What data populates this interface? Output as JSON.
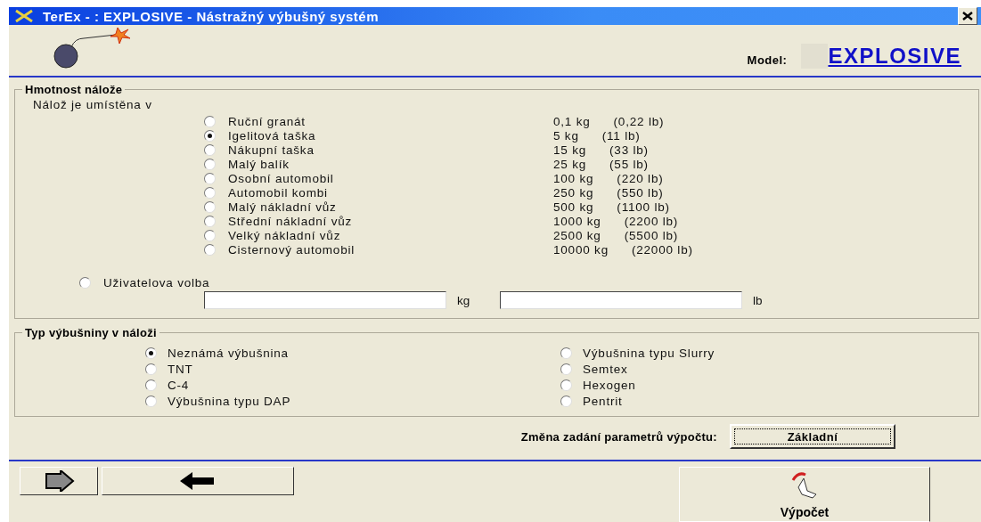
{
  "window": {
    "title": "TerEx - : EXPLOSIVE - Nástražný výbušný systém"
  },
  "header": {
    "model_label": "Model:",
    "model_value": "EXPLOSIVE"
  },
  "charge_group": {
    "title": "Hmotnost nálože",
    "prompt": "Nálož je umístěna v",
    "options": [
      {
        "label": "Ruční granát",
        "kg": "0,1 kg",
        "lb": "(0,22 lb)",
        "selected": false
      },
      {
        "label": "Igelitová taška",
        "kg": "5 kg",
        "lb": "(11 lb)",
        "selected": true
      },
      {
        "label": "Nákupní taška",
        "kg": "15 kg",
        "lb": "(33 lb)",
        "selected": false
      },
      {
        "label": "Malý balík",
        "kg": "25 kg",
        "lb": "(55 lb)",
        "selected": false
      },
      {
        "label": "Osobní automobil",
        "kg": "100 kg",
        "lb": "(220 lb)",
        "selected": false
      },
      {
        "label": "Automobil kombi",
        "kg": "250 kg",
        "lb": "(550 lb)",
        "selected": false
      },
      {
        "label": "Malý nákladní vůz",
        "kg": "500 kg",
        "lb": "(1100 lb)",
        "selected": false
      },
      {
        "label": "Střední nákladní vůz",
        "kg": "1000 kg",
        "lb": "(2200 lb)",
        "selected": false
      },
      {
        "label": "Velký nákladní vůz",
        "kg": "2500 kg",
        "lb": "(5500 lb)",
        "selected": false
      },
      {
        "label": "Cisternový automobil",
        "kg": "10000 kg",
        "lb": "(22000 lb)",
        "selected": false
      }
    ],
    "custom": {
      "label": "Uživatelova volba",
      "selected": false,
      "kg_unit": "kg",
      "lb_unit": "lb"
    }
  },
  "explosive_group": {
    "title": "Typ výbušniny v náloži",
    "options": [
      {
        "label": "Neznámá výbušnina",
        "selected": true
      },
      {
        "label": "TNT",
        "selected": false
      },
      {
        "label": "C-4",
        "selected": false
      },
      {
        "label": "Výbušnina typu DAP",
        "selected": false
      },
      {
        "label": "Výbušnina typu Slurry",
        "selected": false
      },
      {
        "label": "Semtex",
        "selected": false
      },
      {
        "label": "Hexogen",
        "selected": false
      },
      {
        "label": "Pentrit",
        "selected": false
      }
    ]
  },
  "parameters": {
    "label": "Změna zadání parametrů výpočtu:",
    "button": "Základní"
  },
  "footer": {
    "calculate": "Výpočet"
  }
}
